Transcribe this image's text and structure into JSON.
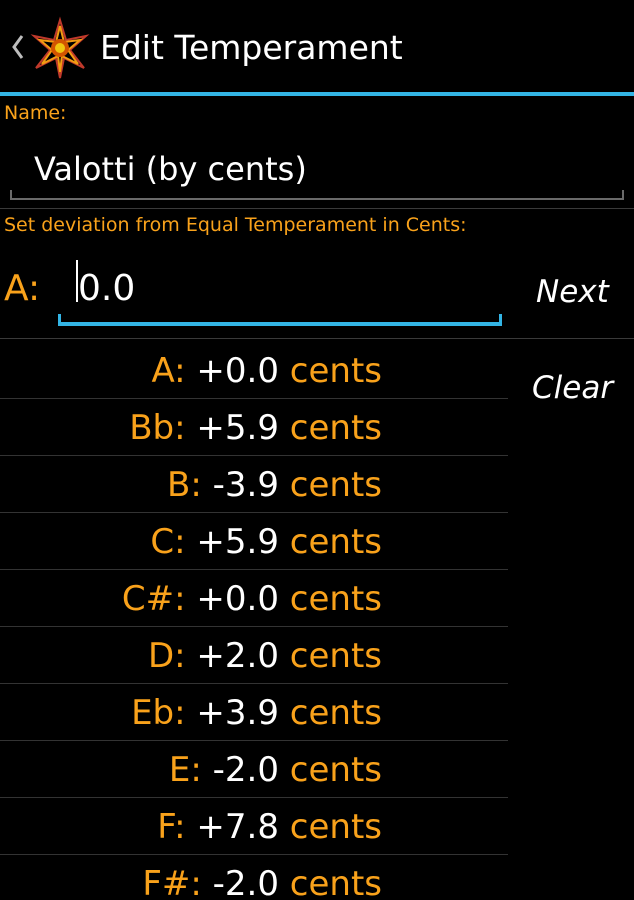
{
  "header": {
    "title": "Edit Temperament"
  },
  "name": {
    "label": "Name:",
    "value": "Valotti (by cents)"
  },
  "deviation": {
    "label": "Set deviation from Equal Temperament in Cents:",
    "current_note": "A:",
    "current_value": "0.0"
  },
  "buttons": {
    "next": "Next",
    "clear": "Clear"
  },
  "unit": "cents",
  "notes": [
    {
      "note": "A:",
      "value": "+0.0"
    },
    {
      "note": "Bb:",
      "value": "+5.9"
    },
    {
      "note": "B:",
      "value": "-3.9"
    },
    {
      "note": "C:",
      "value": "+5.9"
    },
    {
      "note": "C#:",
      "value": "+0.0"
    },
    {
      "note": "D:",
      "value": "+2.0"
    },
    {
      "note": "Eb:",
      "value": "+3.9"
    },
    {
      "note": "E:",
      "value": "-2.0"
    },
    {
      "note": "F:",
      "value": "+7.8"
    },
    {
      "note": "F#:",
      "value": "-2.0"
    }
  ],
  "colors": {
    "accent": "#33b5e5",
    "label": "#f9a21b",
    "background": "#000000",
    "text": "#ffffff"
  },
  "icons": {
    "back": "chevron-left-icon",
    "app": "star-app-icon"
  }
}
